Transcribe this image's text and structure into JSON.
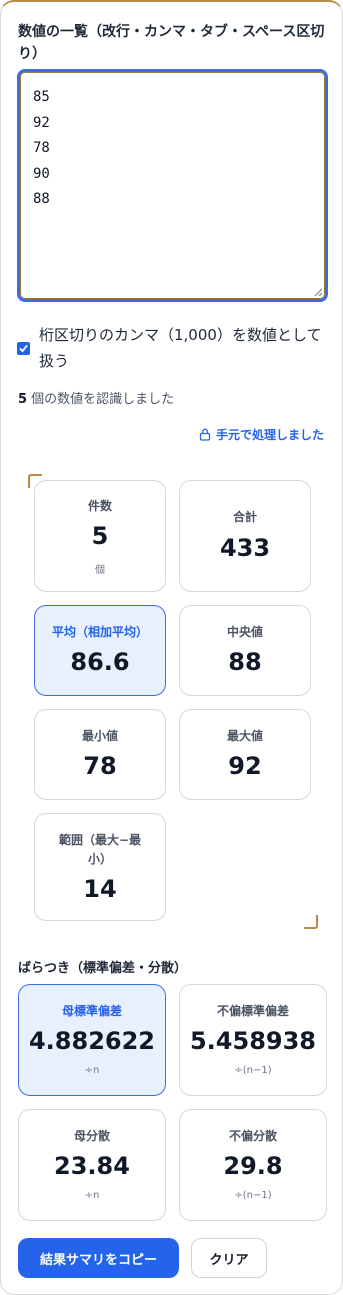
{
  "input": {
    "label": "数値の一覧（改行・カンマ・タブ・スペース区切り）",
    "lines": [
      "85",
      "92",
      "78",
      "90",
      "88"
    ]
  },
  "option": {
    "checked": true,
    "label": "桁区切りのカンマ（1,000）を数値として扱う"
  },
  "status": {
    "count": "5",
    "message": " 個の数値を認識しました",
    "local_processing": "手元で処理しました"
  },
  "stats": {
    "count": {
      "title": "件数",
      "value": "5",
      "unit": "個"
    },
    "sum": {
      "title": "合計",
      "value": "433"
    },
    "mean": {
      "title": "平均（相加平均）",
      "value": "86.6"
    },
    "median": {
      "title": "中央値",
      "value": "88"
    },
    "min": {
      "title": "最小値",
      "value": "78"
    },
    "max": {
      "title": "最大値",
      "value": "92"
    },
    "range": {
      "title": "範囲（最大−最小）",
      "value": "14"
    }
  },
  "dispersion": {
    "heading": "ばらつき（標準偏差・分散）",
    "pop_sd": {
      "title": "母標準偏差",
      "value": "4.882622",
      "note": "÷n"
    },
    "sample_sd": {
      "title": "不偏標準偏差",
      "value": "5.458938",
      "note": "÷(n−1)"
    },
    "pop_var": {
      "title": "母分散",
      "value": "23.84",
      "note": "÷n"
    },
    "sample_var": {
      "title": "不偏分散",
      "value": "29.8",
      "note": "÷(n−1)"
    }
  },
  "actions": {
    "copy": "結果サマリをコピー",
    "clear": "クリア"
  },
  "colors": {
    "accent": "#2563eb",
    "highlight_bg": "#e8f0fe",
    "frame": "#b98b47"
  }
}
